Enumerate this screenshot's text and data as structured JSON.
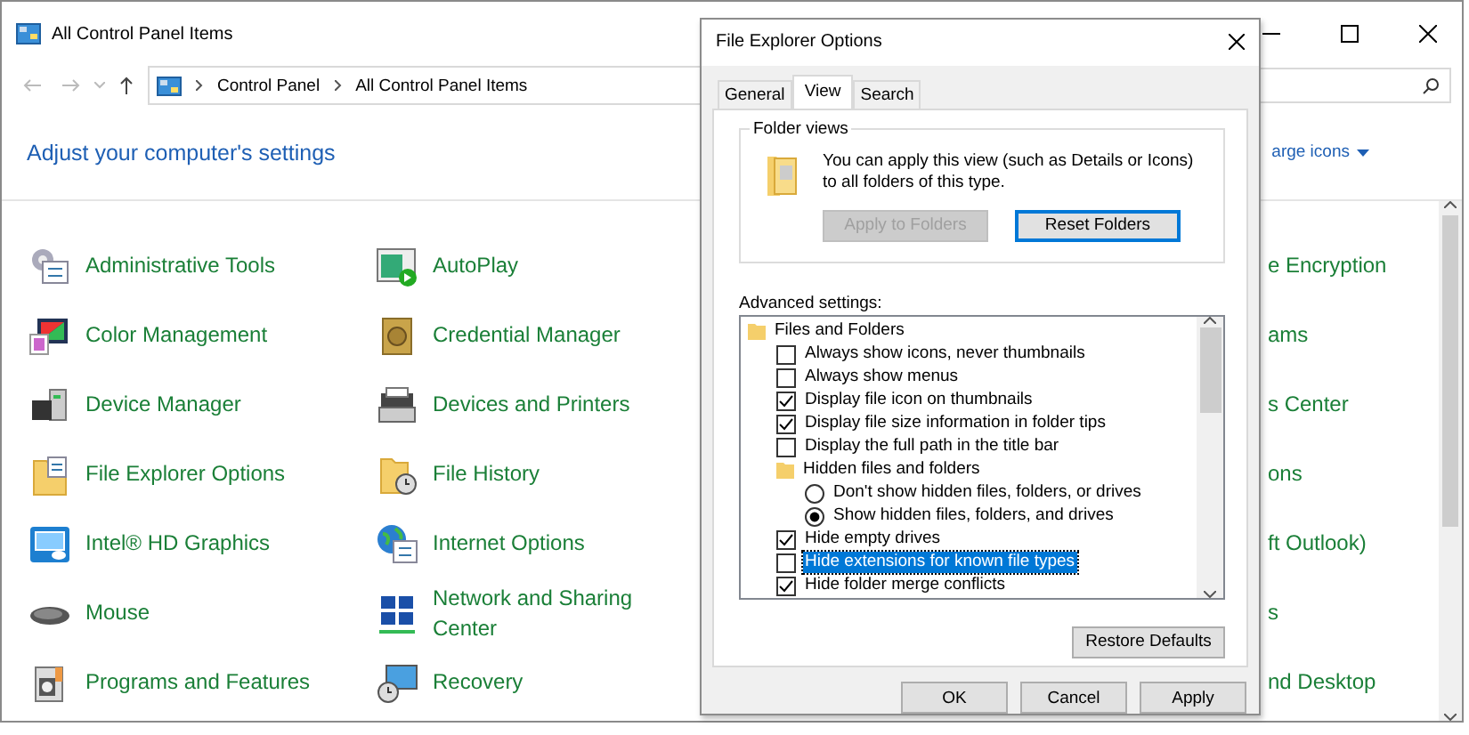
{
  "window": {
    "title": "All Control Panel Items"
  },
  "address": {
    "path": [
      "Control Panel",
      "All Control Panel Items"
    ]
  },
  "heading": "Adjust your computer's settings",
  "view_by": {
    "value": "arge icons"
  },
  "columns": [
    {
      "items": [
        {
          "label": "Administrative Tools"
        },
        {
          "label": "Color Management"
        },
        {
          "label": "Device Manager"
        },
        {
          "label": "File Explorer Options"
        },
        {
          "label": "Intel® HD Graphics"
        },
        {
          "label": "Mouse"
        },
        {
          "label": "Programs and Features"
        }
      ]
    },
    {
      "items": [
        {
          "label": "AutoPlay"
        },
        {
          "label": "Credential Manager"
        },
        {
          "label": "Devices and Printers"
        },
        {
          "label": "File History"
        },
        {
          "label": "Internet Options"
        },
        {
          "label": "Network and Sharing Center"
        },
        {
          "label": "Recovery"
        }
      ]
    },
    {
      "items": [
        {
          "label": "e Encryption"
        },
        {
          "label": "ams"
        },
        {
          "label": "s Center"
        },
        {
          "label": "ons"
        },
        {
          "label": "ft Outlook)"
        },
        {
          "label": "s"
        },
        {
          "label": "nd Desktop"
        }
      ]
    }
  ],
  "dialog": {
    "title": "File Explorer Options",
    "tabs": [
      {
        "label": "General",
        "selected": false
      },
      {
        "label": "View",
        "selected": true
      },
      {
        "label": "Search",
        "selected": false
      }
    ],
    "folder_views": {
      "legend": "Folder views",
      "text": "You can apply this view (such as Details or Icons) to all folders of this type.",
      "buttons": [
        {
          "label": "Apply to Folders",
          "disabled": true,
          "focused": false
        },
        {
          "label": "Reset Folders",
          "disabled": false,
          "focused": true
        }
      ]
    },
    "advanced": {
      "label": "Advanced settings:",
      "tree": [
        {
          "kind": "folder",
          "label": "Files and Folders",
          "selected": false,
          "children": [
            {
              "kind": "checkbox",
              "label": "Always show icons, never thumbnails",
              "checked": false,
              "selected": false
            },
            {
              "kind": "checkbox",
              "label": "Always show menus",
              "checked": false,
              "selected": false
            },
            {
              "kind": "checkbox",
              "label": "Display file icon on thumbnails",
              "checked": true,
              "selected": false
            },
            {
              "kind": "checkbox",
              "label": "Display file size information in folder tips",
              "checked": true,
              "selected": false
            },
            {
              "kind": "checkbox",
              "label": "Display the full path in the title bar",
              "checked": false,
              "selected": false
            },
            {
              "kind": "folder",
              "label": "Hidden files and folders",
              "selected": false,
              "children": [
                {
                  "kind": "radio",
                  "label": "Don't show hidden files, folders, or drives",
                  "checked": false,
                  "selected": false
                },
                {
                  "kind": "radio",
                  "label": "Show hidden files, folders, and drives",
                  "checked": true,
                  "selected": false
                }
              ]
            },
            {
              "kind": "checkbox",
              "label": "Hide empty drives",
              "checked": true,
              "selected": false
            },
            {
              "kind": "checkbox",
              "label": "Hide extensions for known file types",
              "checked": false,
              "selected": true
            },
            {
              "kind": "checkbox",
              "label": "Hide folder merge conflicts",
              "checked": true,
              "selected": false
            }
          ]
        }
      ]
    },
    "restore_button": "Restore Defaults",
    "buttons": [
      "OK",
      "Cancel",
      "Apply"
    ]
  }
}
